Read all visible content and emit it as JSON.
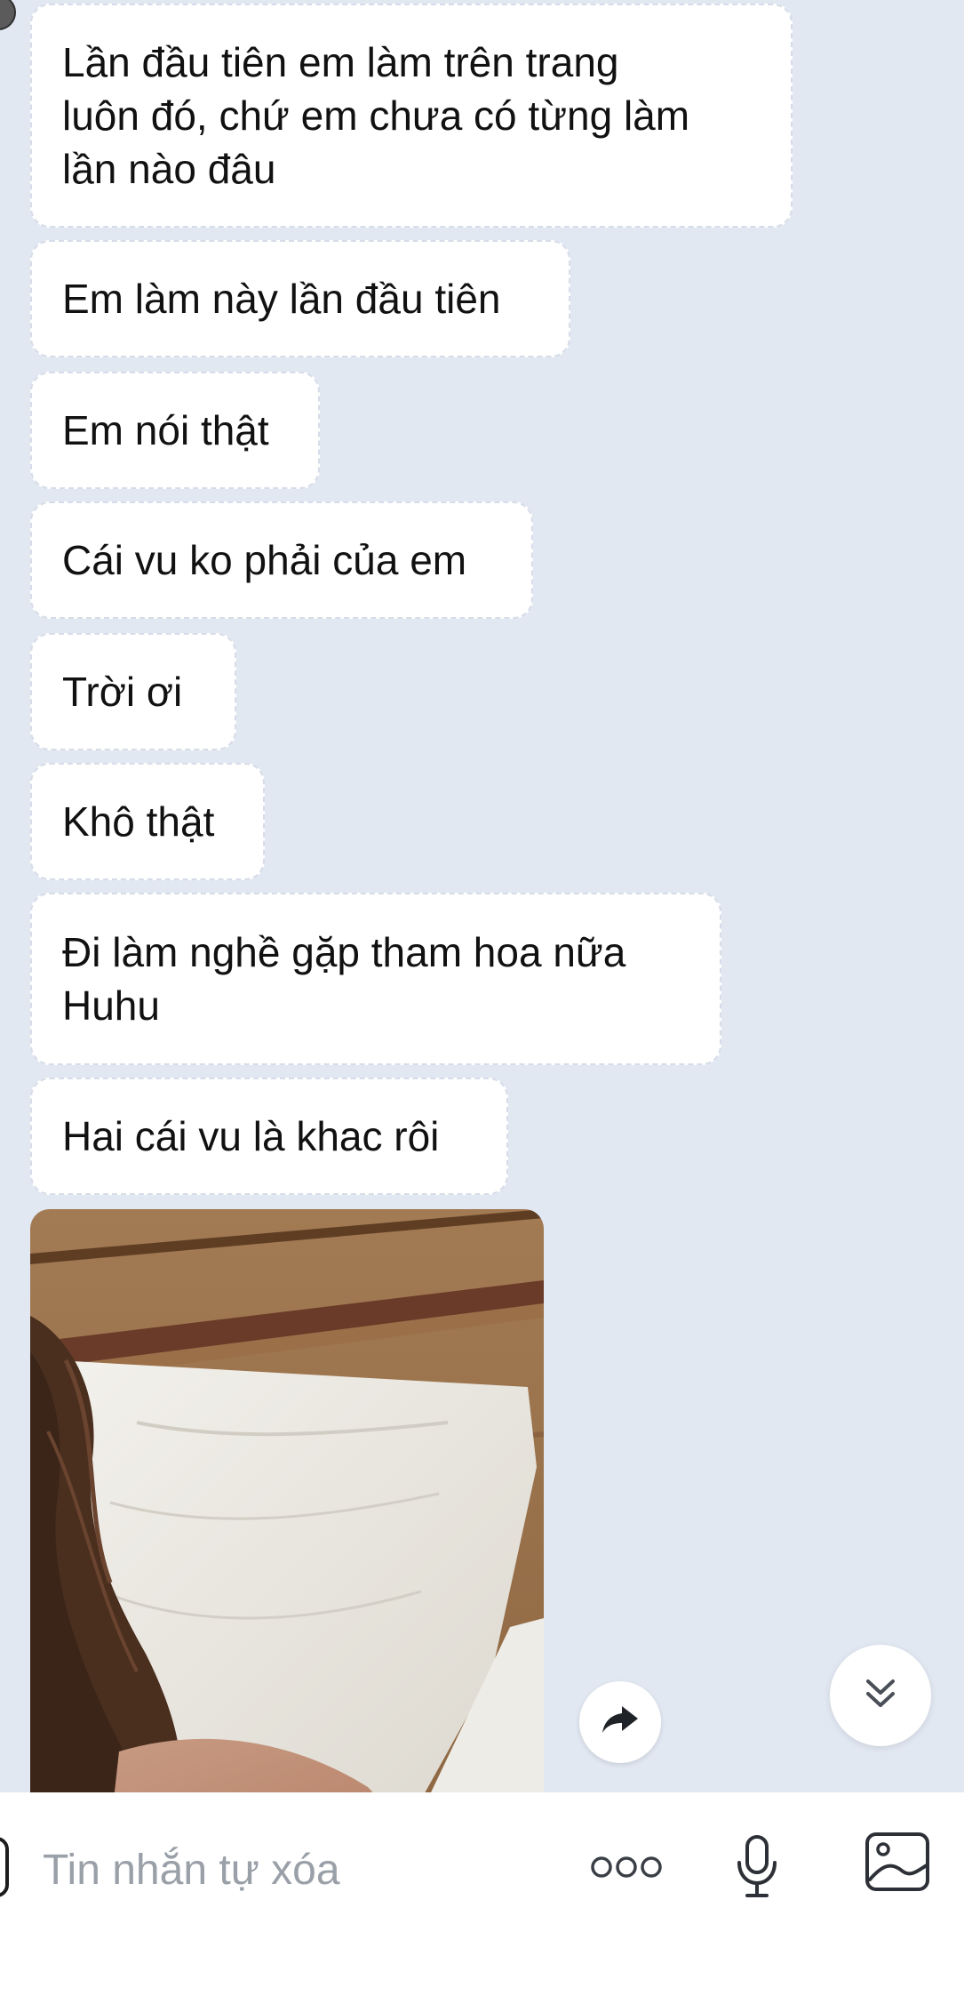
{
  "messages": [
    {
      "lines": [
        "Lần đầu tiên em làm trên trang",
        "luôn đó, chứ em chưa có từng làm",
        "lần nào đâu"
      ]
    },
    {
      "lines": [
        "Em làm này lần đầu tiên"
      ]
    },
    {
      "lines": [
        "Em nói thật"
      ]
    },
    {
      "lines": [
        "Cái vu ko phải của em"
      ]
    },
    {
      "lines": [
        "Trời ơi"
      ]
    },
    {
      "lines": [
        "Khô thật"
      ]
    },
    {
      "lines": [
        "Đi làm nghề gặp tham hoa nữa",
        "Huhu"
      ]
    },
    {
      "lines": [
        "Hai cái vu là khac rôi"
      ]
    }
  ],
  "composer": {
    "placeholder": "Tin nhắn tự xóa"
  },
  "icons": {
    "share": "share-arrow-icon",
    "scroll_down": "double-chevron-down-icon",
    "more": "more-options-icon",
    "mic": "microphone-icon",
    "image": "image-gallery-icon"
  },
  "colors": {
    "chat_background": "#e2e8f2",
    "bubble": "#ffffff",
    "text": "#111111",
    "placeholder": "#9aa0a8"
  }
}
